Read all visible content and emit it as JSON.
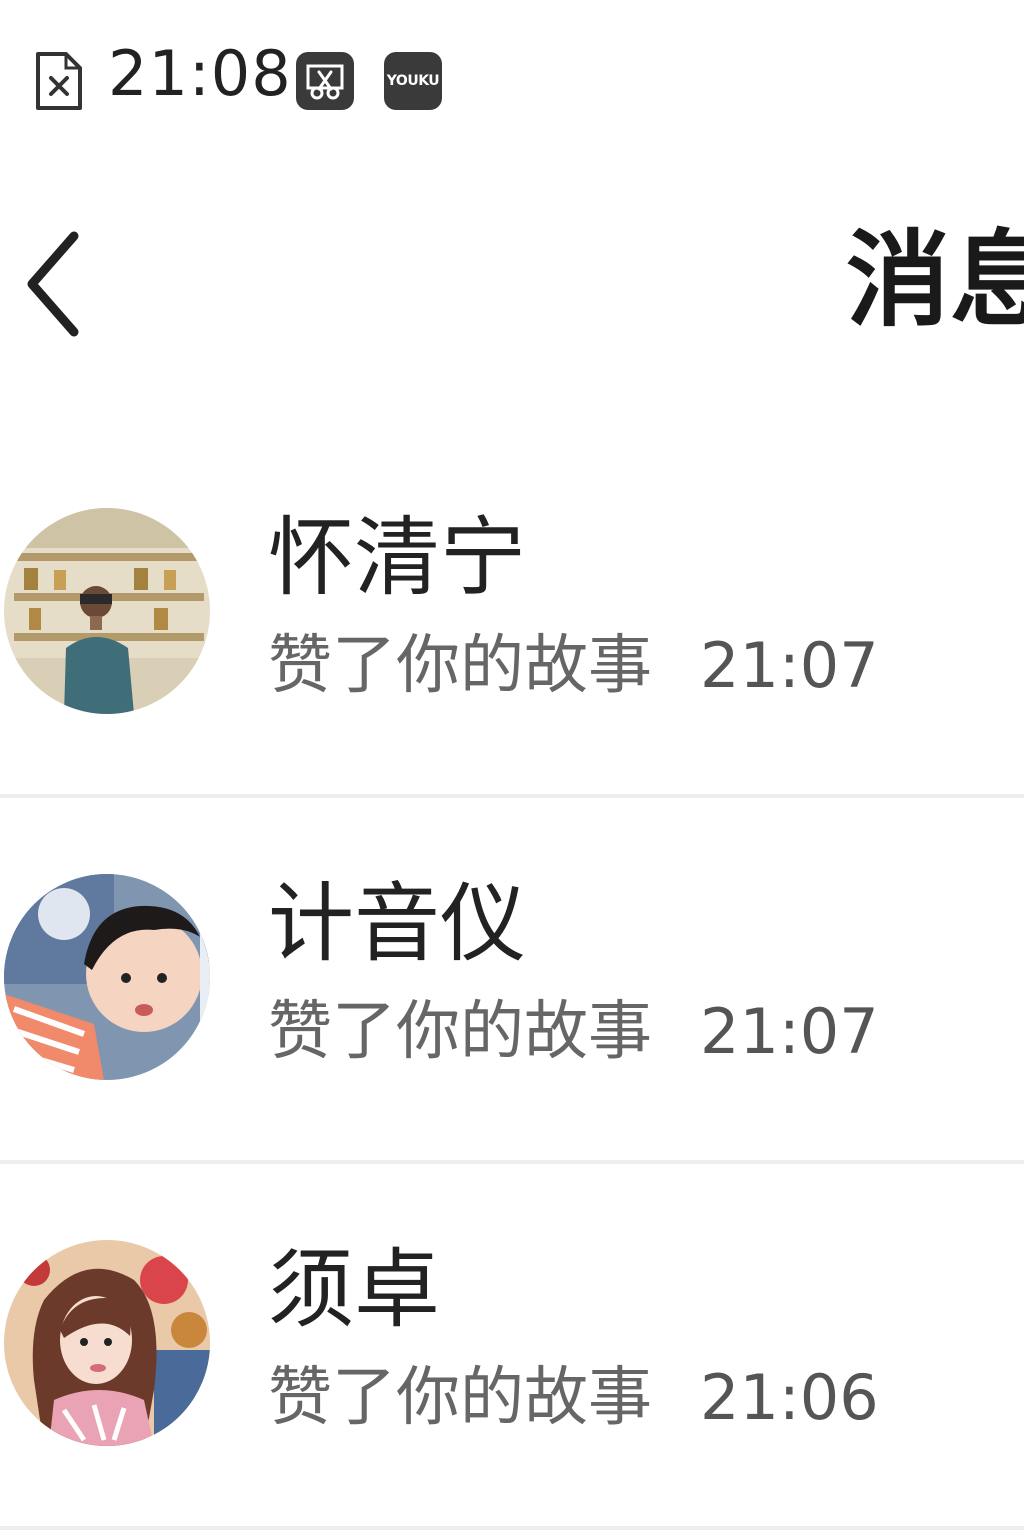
{
  "status_bar": {
    "time": "21:08",
    "icons": [
      "sim-error-icon",
      "screenshot-scissors-icon",
      "youku-icon"
    ],
    "youku_label": "YOUKU"
  },
  "header": {
    "title": "消息",
    "back_icon": "chevron-left-icon"
  },
  "messages": [
    {
      "name": "怀清宁",
      "action": "赞了你的故事",
      "time": "21:07"
    },
    {
      "name": "计音仪",
      "action": "赞了你的故事",
      "time": "21:07"
    },
    {
      "name": "须卓",
      "action": "赞了你的故事",
      "time": "21:06"
    }
  ],
  "colors": {
    "background": "#ffffff",
    "primary_text": "#222222",
    "secondary_text": "#666666",
    "divider": "#eeeeee",
    "status_icon_bg": "#3a3a3a"
  }
}
